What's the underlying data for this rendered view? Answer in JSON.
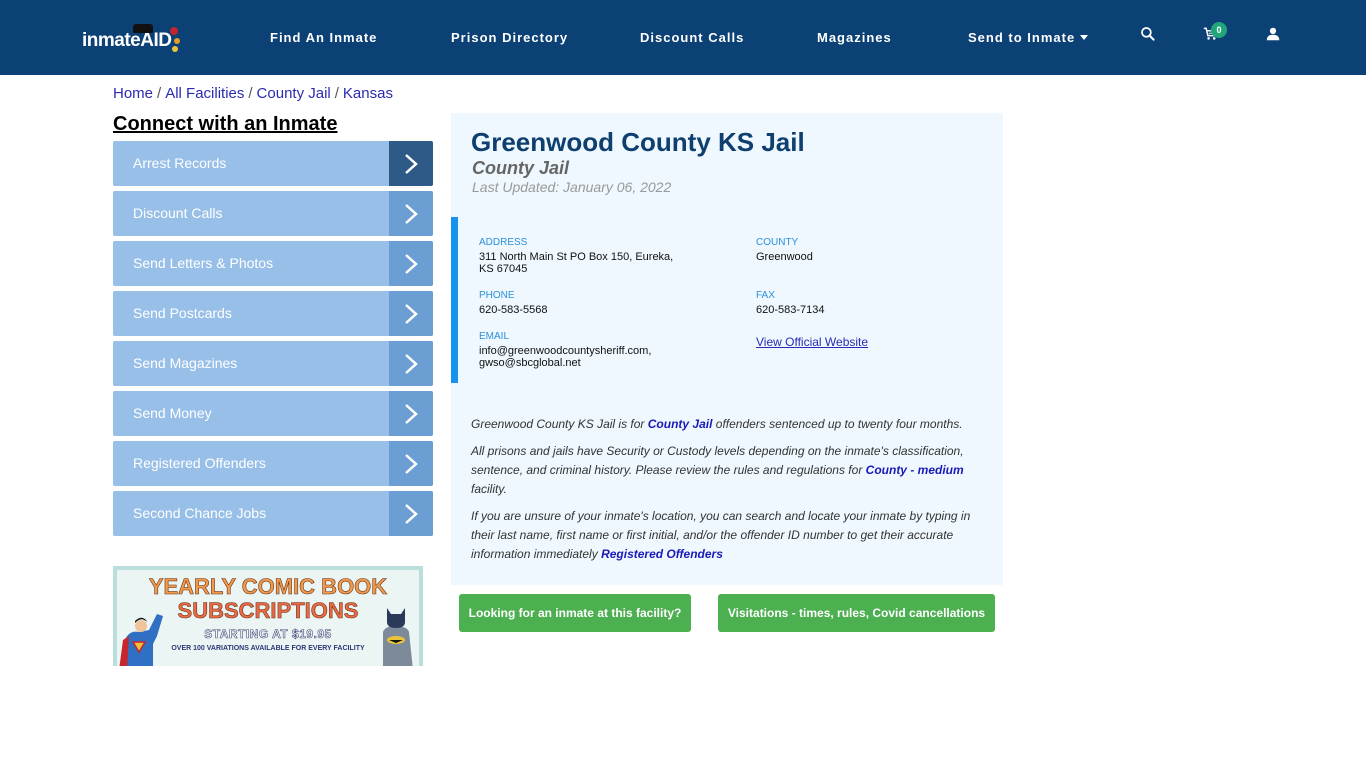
{
  "brand": {
    "logo_part1": "inmate",
    "logo_part2": "AID",
    "colors": {
      "navbar": "#0b4175",
      "sidebar_item": "#97bfe8",
      "sidebar_arrow": "#6b9fd3",
      "sidebar_arrow_active": "#2d5a86",
      "panel_bg": "#eef8fe",
      "accent_bar": "#1593ee",
      "button_green": "#4caf50",
      "cart_badge": "#21a67a"
    }
  },
  "nav": {
    "items": [
      {
        "label": "Find An Inmate"
      },
      {
        "label": "Prison Directory"
      },
      {
        "label": "Discount Calls"
      },
      {
        "label": "Magazines"
      },
      {
        "label": "Send to Inmate",
        "has_dropdown": true
      }
    ],
    "icons": [
      "search-icon",
      "cart-icon",
      "user-icon"
    ],
    "cart_count": "0"
  },
  "breadcrumb": [
    {
      "label": "Home"
    },
    {
      "label": "All Facilities"
    },
    {
      "label": "County Jail"
    },
    {
      "label": "Kansas"
    }
  ],
  "sidebar": {
    "title": "Connect with an Inmate",
    "items": [
      {
        "label": "Arrest Records",
        "active": true
      },
      {
        "label": "Discount Calls"
      },
      {
        "label": "Send Letters & Photos"
      },
      {
        "label": "Send Postcards"
      },
      {
        "label": "Send Magazines"
      },
      {
        "label": "Send Money"
      },
      {
        "label": "Registered Offenders"
      },
      {
        "label": "Second Chance Jobs"
      }
    ],
    "ad": {
      "line1": "YEARLY COMIC BOOK",
      "line2": "SUBSCRIPTIONS",
      "line3": "STARTING AT $19.95",
      "line4": "OVER 100 VARIATIONS AVAILABLE FOR EVERY FACILITY"
    }
  },
  "facility": {
    "name": "Greenwood County KS Jail",
    "type": "County Jail",
    "last_updated": "Last Updated: January 06, 2022",
    "address_label": "ADDRESS",
    "address_line1": "311 North Main St PO Box 150, Eureka,",
    "address_line2": "KS 67045",
    "county_label": "COUNTY",
    "county": "Greenwood",
    "phone_label": "PHONE",
    "phone": "620-583-5568",
    "fax_label": "FAX",
    "fax": "620-583-7134",
    "email_label": "EMAIL",
    "email_line1": "info@greenwoodcountysheriff.com,",
    "email_line2": "gwso@sbcglobal.net",
    "website_link": "View Official Website"
  },
  "description": {
    "p1_pre": "Greenwood County KS Jail is for ",
    "p1_link": "County Jail",
    "p1_post": " offenders sentenced up to twenty four months.",
    "p2_pre": "All prisons and jails have Security or Custody levels depending on the inmate's classification, sentence, and criminal history. Please review the rules and regulations for ",
    "p2_link": "County - medium",
    "p2_post": " facility.",
    "p3_pre": "If you are unsure of your inmate's location, you can search and locate your inmate by typing in their last name, first name or first initial, and/or the offender ID number to get their accurate information immediately ",
    "p3_link": "Registered Offenders"
  },
  "buttons": {
    "find_inmate": "Looking for an inmate at this facility?",
    "visitations": "Visitations - times, rules, Covid cancellations"
  }
}
